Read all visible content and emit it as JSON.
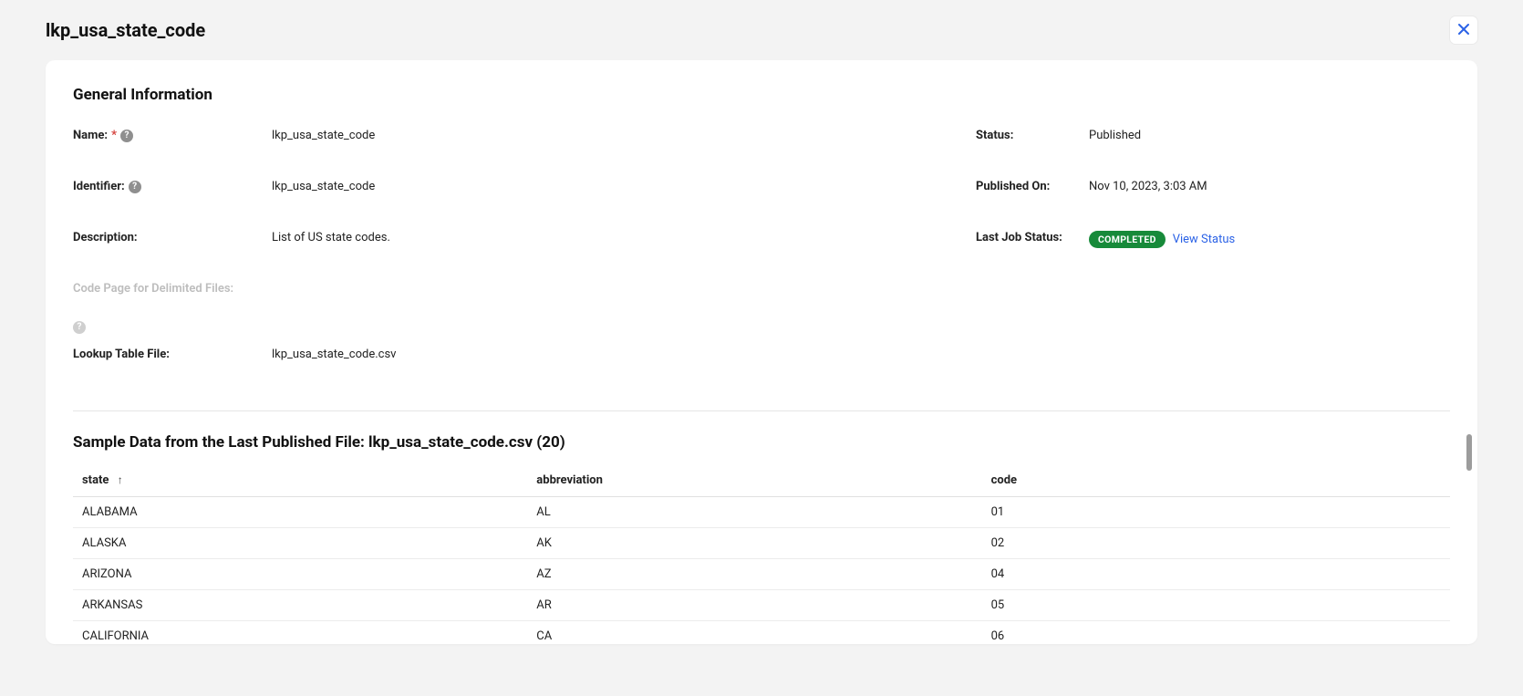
{
  "header": {
    "title": "lkp_usa_state_code"
  },
  "general_info": {
    "section_title": "General Information",
    "name_label": "Name:",
    "name_value": "lkp_usa_state_code",
    "identifier_label": "Identifier:",
    "identifier_value": "lkp_usa_state_code",
    "description_label": "Description:",
    "description_value": "List of US state codes.",
    "code_page_label": "Code Page for Delimited Files:",
    "lookup_file_label": "Lookup Table File:",
    "lookup_file_value": "lkp_usa_state_code.csv",
    "status_label": "Status:",
    "status_value": "Published",
    "published_on_label": "Published On:",
    "published_on_value": "Nov 10, 2023, 3:03 AM",
    "last_job_label": "Last Job Status:",
    "last_job_badge": "COMPLETED",
    "view_status_link": "View Status"
  },
  "sample": {
    "title": "Sample Data from the Last Published File: lkp_usa_state_code.csv (20)",
    "columns": [
      "state",
      "abbreviation",
      "code"
    ],
    "sort_column": "state",
    "sort_dir": "asc",
    "rows": [
      {
        "state": "ALABAMA",
        "abbreviation": "AL",
        "code": "01"
      },
      {
        "state": "ALASKA",
        "abbreviation": "AK",
        "code": "02"
      },
      {
        "state": "ARIZONA",
        "abbreviation": "AZ",
        "code": "04"
      },
      {
        "state": "ARKANSAS",
        "abbreviation": "AR",
        "code": "05"
      },
      {
        "state": "CALIFORNIA",
        "abbreviation": "CA",
        "code": "06"
      }
    ]
  }
}
